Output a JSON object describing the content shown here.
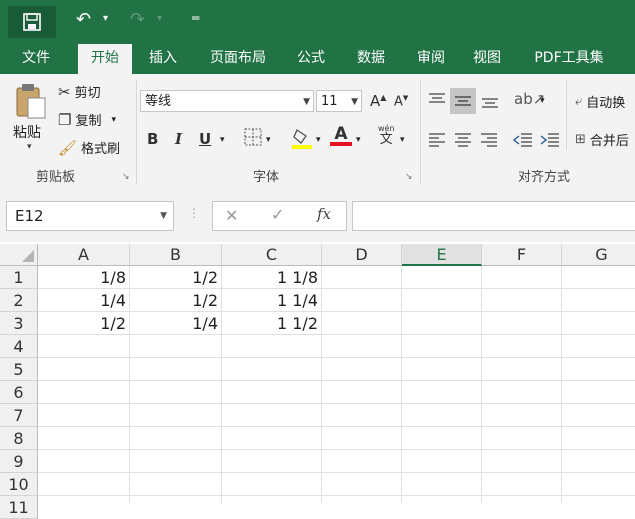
{
  "quick_access": {
    "undo_icon": "undo-icon",
    "redo_icon": "redo-icon",
    "customize_icon": "customize-icon"
  },
  "tabs": [
    "文件",
    "开始",
    "插入",
    "页面布局",
    "公式",
    "数据",
    "审阅",
    "视图",
    "PDF工具集"
  ],
  "active_tab": "开始",
  "clipboard": {
    "paste": "粘贴",
    "cut": "剪切",
    "copy": "复制",
    "format_painter": "格式刷",
    "group": "剪贴板"
  },
  "font": {
    "name": "等线",
    "size": "11",
    "bold": "B",
    "italic": "I",
    "underline": "U",
    "group": "字体",
    "grow": "A",
    "shrink": "A",
    "phonetic_top": "wén",
    "phonetic_bottom": "文"
  },
  "alignment": {
    "wrap": "自动换",
    "merge": "合并后",
    "group": "对齐方式"
  },
  "formula_bar": {
    "name_box": "E12",
    "fx": "fx",
    "cancel": "✕",
    "enter": "✓",
    "value": ""
  },
  "columns": [
    "A",
    "B",
    "C",
    "D",
    "E",
    "F",
    "G"
  ],
  "selected_column": "E",
  "rows": [
    "1",
    "2",
    "3",
    "4",
    "5",
    "6",
    "7",
    "8",
    "9",
    "10",
    "11"
  ],
  "cells": [
    [
      "1/8",
      "1/2",
      "1 1/8"
    ],
    [
      "1/4",
      "1/2",
      "1 1/4"
    ],
    [
      "1/2",
      "1/4",
      "1 1/2"
    ]
  ],
  "colors": {
    "brand": "#217346",
    "font_color": "#e81123",
    "highlight": "#ffff00"
  }
}
